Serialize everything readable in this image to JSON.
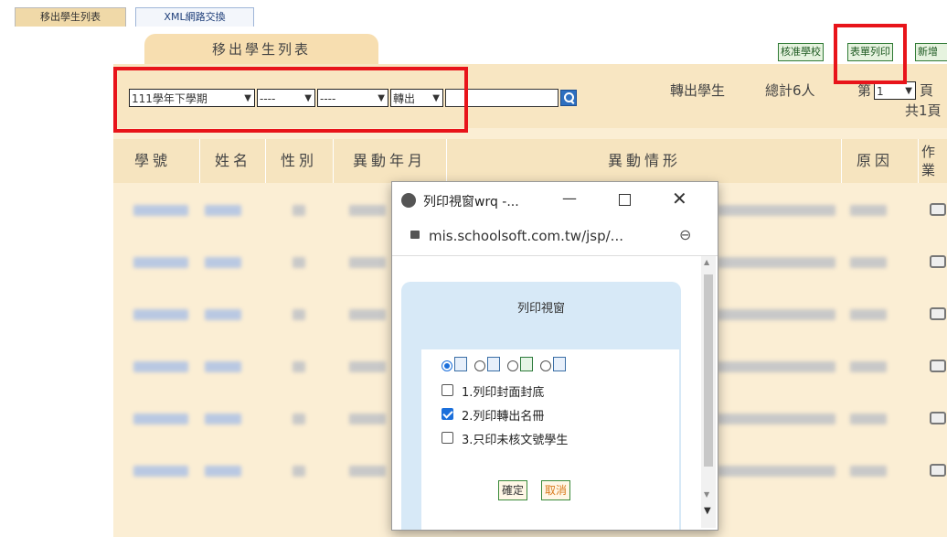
{
  "top_tabs": [
    "移出學生列表",
    "XML網路交換"
  ],
  "panel_title": "移出學生列表",
  "toolbar_buttons": [
    "核准學校",
    "表單列印",
    "新增"
  ],
  "filters": {
    "semester": "111學年下學期",
    "filter2": "----",
    "filter3": "----",
    "type": "轉出",
    "search_value": ""
  },
  "summary": {
    "label": "轉出學生",
    "total": "總計6人",
    "page_prefix": "第",
    "page": "1",
    "page_suffix": "頁",
    "pages_total": "共1頁"
  },
  "table": {
    "headers": [
      "學號",
      "姓名",
      "性別",
      "異動年月",
      "異動情形",
      "原因",
      "作業"
    ],
    "row_count": 6
  },
  "popup": {
    "title": "列印視窗wrq -...",
    "url": "mis.schoolsoft.com.tw/jsp/...",
    "heading": "列印視窗",
    "formats": [
      "ie",
      "word",
      "excel",
      "text"
    ],
    "selected_format": 0,
    "options": [
      {
        "label": "1.列印封面封底",
        "checked": false
      },
      {
        "label": "2.列印轉出名冊",
        "checked": true
      },
      {
        "label": "3.只印未核文號學生",
        "checked": false
      }
    ],
    "confirm": "確定",
    "cancel": "取消"
  }
}
